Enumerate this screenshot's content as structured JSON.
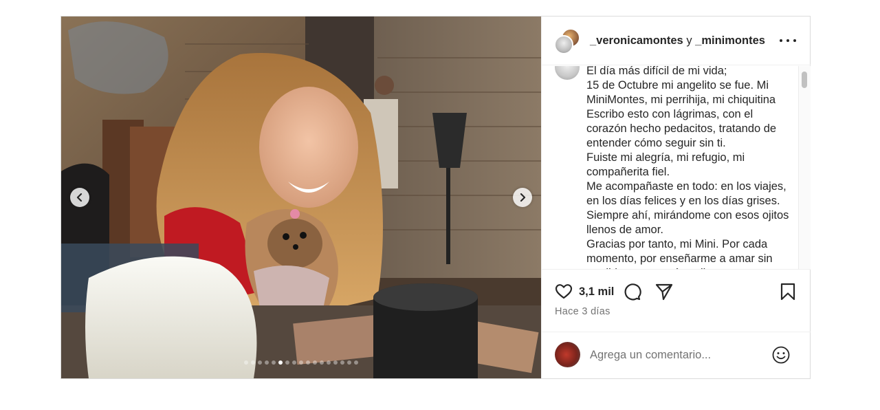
{
  "header": {
    "user1": "_veronicamontes",
    "connector": " y ",
    "user2": "_minimontes"
  },
  "caption": {
    "lines": [
      "El día más difícil de mi vida;",
      "15 de Octubre mi angelito se fue. Mi MiniMontes, mi perrihija, mi chiquitina",
      "Escribo esto con lágrimas, con el corazón hecho pedacitos, tratando de entender cómo seguir sin ti.",
      "Fuiste mi alegría, mi refugio, mi compañerita fiel.",
      "Me acompañaste en todo: en los viajes, en los días felices y en los días grises. Siempre ahí, mirándome con esos ojitos llenos de amor.",
      "Gracias por tanto, mi Mini. Por cada momento, por enseñarme a amar sin medida y a ser más valiente."
    ]
  },
  "actions": {
    "likes": "3,1 mil",
    "time": "Hace 3 días",
    "icons": [
      "heart-icon",
      "comment-icon",
      "share-icon",
      "bookmark-icon"
    ]
  },
  "comment": {
    "placeholder": "Agrega un comentario..."
  },
  "carousel": {
    "slide_count": 17,
    "active_index": 5
  }
}
